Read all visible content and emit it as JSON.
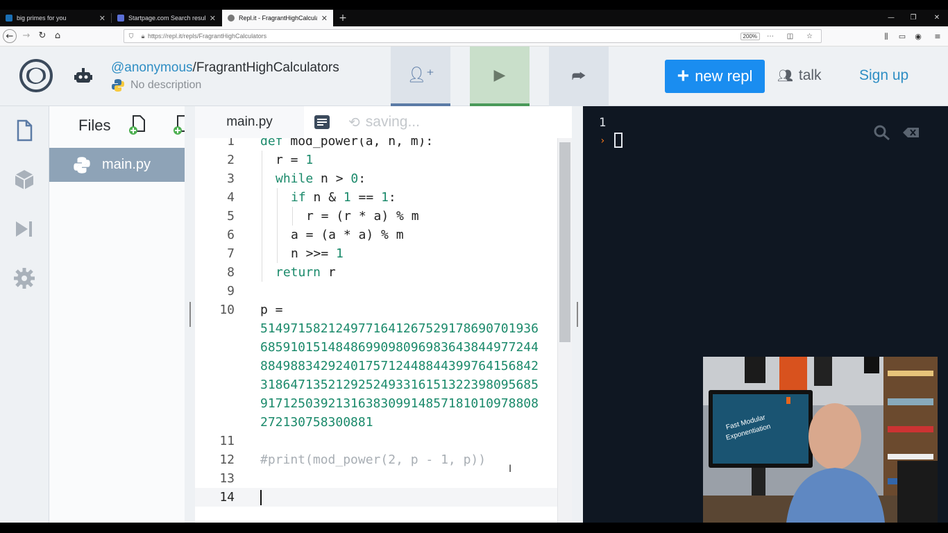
{
  "browser": {
    "tabs": [
      {
        "title": "big primes for you",
        "active": false
      },
      {
        "title": "Startpage.com Search results",
        "active": false
      },
      {
        "title": "Repl.it - FragrantHighCalculators",
        "active": true
      }
    ],
    "url": "https://repl.it/repls/FragrantHighCalculators",
    "zoom": "200%"
  },
  "header": {
    "owner": "@anonymous",
    "separator": "/",
    "repl_name": "FragrantHighCalculators",
    "description": "No description",
    "new_repl_label": "new repl",
    "talk_label": "talk",
    "signup_label": "Sign up"
  },
  "files": {
    "title": "Files",
    "items": [
      {
        "name": "main.py"
      }
    ]
  },
  "editor": {
    "tab_label": "main.py",
    "status": "saving...",
    "lines": [
      {
        "n": "1",
        "text": "def mod_power(a, n, m):"
      },
      {
        "n": "2",
        "text": "r = 1"
      },
      {
        "n": "3",
        "text": "while n > 0:"
      },
      {
        "n": "4",
        "text": "if n & 1 == 1:"
      },
      {
        "n": "5",
        "text": "r = (r * a) % m"
      },
      {
        "n": "6",
        "text": "a = (a * a) % m"
      },
      {
        "n": "7",
        "text": "n >>= 1"
      },
      {
        "n": "8",
        "text": "return r"
      },
      {
        "n": "9",
        "text": ""
      },
      {
        "n": "10",
        "text": "p ="
      },
      {
        "n": "",
        "text": "514971582124977164126752917869070193668591015148486990980969836438449772448849883429240175712448844399764156842318647135212925249331615132239809568591712503921316383099148571810109788082721307583008881"
      },
      {
        "n": "11",
        "text": ""
      },
      {
        "n": "12",
        "text": "#print(mod_power(2, p - 1, p))"
      },
      {
        "n": "13",
        "text": ""
      },
      {
        "n": "14",
        "text": ""
      }
    ],
    "p_wrapped": [
      "514971582124977164126752917869070193 6",
      "685910151484869909809698364384497724 4",
      "884988342924017571244884439976415684 2",
      "318647135212925249331615132239809568 5",
      "917125039213163830991485718101097880 8",
      "272130758300881"
    ]
  },
  "console": {
    "output_line": "1",
    "prompt": "›"
  },
  "colors": {
    "accent": "#1a8df0",
    "keyword": "#1b8a6b",
    "console_bg": "#0f1722",
    "selected_file": "#8ea3b7"
  },
  "icons": [
    "shield-icon",
    "lock-icon",
    "files-icon",
    "packages-icon",
    "debugger-icon",
    "settings-icon",
    "add-file-icon",
    "add-folder-icon",
    "format-icon",
    "history-icon",
    "search-icon",
    "clear-icon",
    "invite-icon",
    "run-icon",
    "share-icon",
    "python-icon",
    "repl-logo-icon",
    "robot-avatar-icon",
    "talk-icon"
  ]
}
